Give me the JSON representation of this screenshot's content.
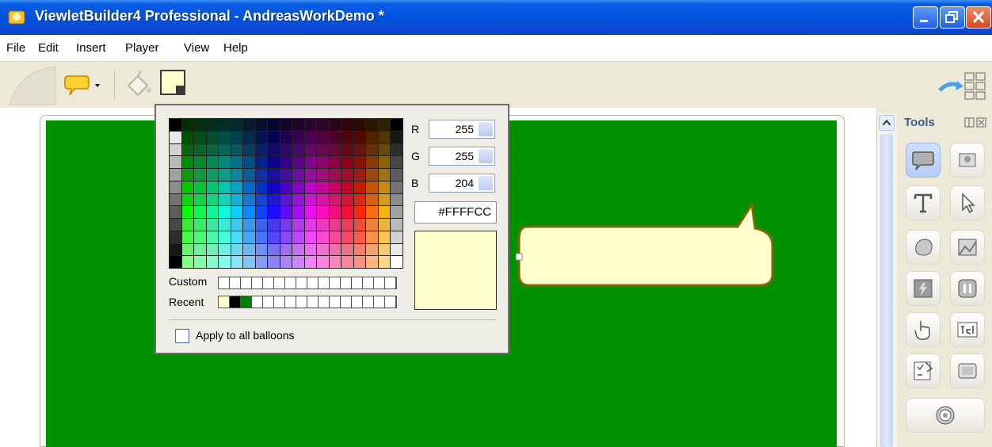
{
  "window": {
    "title": "ViewletBuilder4 Professional - AndreasWorkDemo *"
  },
  "menu": {
    "items": [
      "File",
      "Edit",
      "Insert",
      "Player",
      "View",
      "Help"
    ]
  },
  "toolbar": {
    "icons": [
      "balloon-tool-icon",
      "fill-bucket-icon",
      "fill-color-swatch-icon",
      "publish-icon"
    ],
    "fill_color": "#FFFFCC"
  },
  "color_picker": {
    "r_label": "R",
    "r_value": "255",
    "g_label": "G",
    "g_value": "255",
    "b_label": "B",
    "b_value": "204",
    "hex_value": "#FFFFCC",
    "custom_label": "Custom",
    "recent_label": "Recent",
    "recent_colors": [
      "#FFFFCC",
      "#000000",
      "#008000"
    ],
    "apply_all_label": "Apply to all balloons"
  },
  "stage": {
    "background": "#009100"
  },
  "balloon": {
    "fill": "#FFFFCC",
    "border": "#7a6a00"
  },
  "tools_panel": {
    "title": "Tools",
    "tools": [
      "balloon-icon",
      "image-icon",
      "text-icon",
      "pointer-icon",
      "shape-icon",
      "picture-icon",
      "flash-icon",
      "pause-icon",
      "hand-cursor-icon",
      "textbox-icon",
      "quiz-icon",
      "window-icon",
      "spiral-icon"
    ]
  }
}
